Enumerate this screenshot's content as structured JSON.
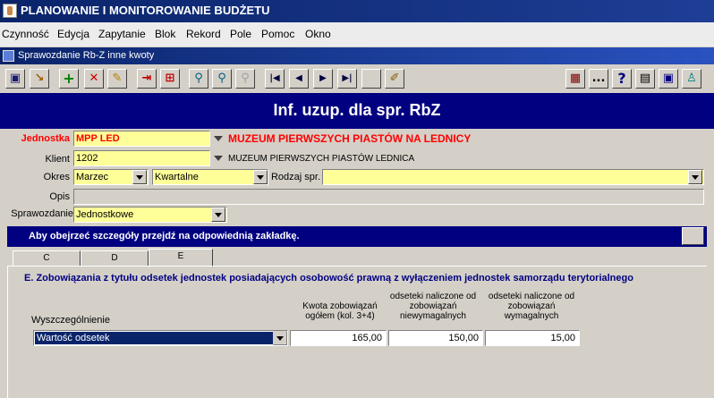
{
  "window": {
    "title": "PLANOWANIE I MONITOROWANIE BUDŻETU"
  },
  "menu": [
    "Czynność",
    "Edycja",
    "Zapytanie",
    "Blok",
    "Rekord",
    "Pole",
    "Pomoc",
    "Okno"
  ],
  "subwindow": {
    "title": "Sprawozdanie Rb-Z inne kwoty"
  },
  "toolbar": {
    "icons": [
      "save-icon",
      "exit-icon",
      "insert-record-icon",
      "delete-record-icon",
      "edit-icon",
      "enter-query-icon",
      "execute-query-icon",
      "search-icon",
      "search-next-icon",
      "search-disabled-icon",
      "first-record-icon",
      "previous-record-icon",
      "next-record-icon",
      "last-record-icon",
      "blank",
      "notes-icon",
      "presentation-icon",
      "more-icon",
      "help-icon",
      "calculator-icon",
      "window-icon",
      "user-icon"
    ],
    "more_label": "...",
    "help_label": "?"
  },
  "banner": {
    "title": "Inf. uzup. dla spr. RbZ"
  },
  "form": {
    "jednostka": {
      "label": "Jednostka",
      "value": "MPP LED",
      "name": "MUZEUM PIERWSZYCH PIASTÓW NA LEDNICY"
    },
    "klient": {
      "label": "Klient",
      "value": "1202",
      "name": "MUZEUM PIERWSZYCH PIASTÓW LEDNICA"
    },
    "okres": {
      "label": "Okres",
      "value": "Marzec",
      "period_type": "Kwartalne"
    },
    "rodzaj": {
      "label": "Rodzaj spr.",
      "value": ""
    },
    "opis": {
      "label": "Opis",
      "value": ""
    },
    "sprawozdanie": {
      "label": "Sprawozdanie",
      "value": "Jednostkowe"
    }
  },
  "info": {
    "message": "Aby obejrzeć szczegóły przejdź na odpowiednią zakładkę."
  },
  "tabs": [
    {
      "label": "C",
      "active": false
    },
    {
      "label": "D",
      "active": false
    },
    {
      "label": "E",
      "active": true
    }
  ],
  "section": {
    "title": "E. Zobowiązania z tytułu odsetek jednostek posiadających  osobowość prawną z wyłączeniem jednostek samorządu terytorialnego",
    "columns": {
      "item": "Wyszczególnienie",
      "col1": [
        "Kwota zobowiązań",
        "ogółem (kol. 3+4)"
      ],
      "col2": [
        "odseteki naliczone od",
        "zobowiązań",
        "niewymagalnych"
      ],
      "col3": [
        "odseteki naliczone od",
        "zobowiązań",
        "wymagalnych"
      ]
    },
    "row": {
      "item": "Wartość odsetek",
      "total": "165,00",
      "nonmature": "150,00",
      "mature": "15,00"
    }
  },
  "colors": {
    "title_bar": "#0a246a",
    "banner": "#000080",
    "required_label": "#ff0000",
    "field_bg": "#ffff99",
    "section_title": "#000080"
  }
}
